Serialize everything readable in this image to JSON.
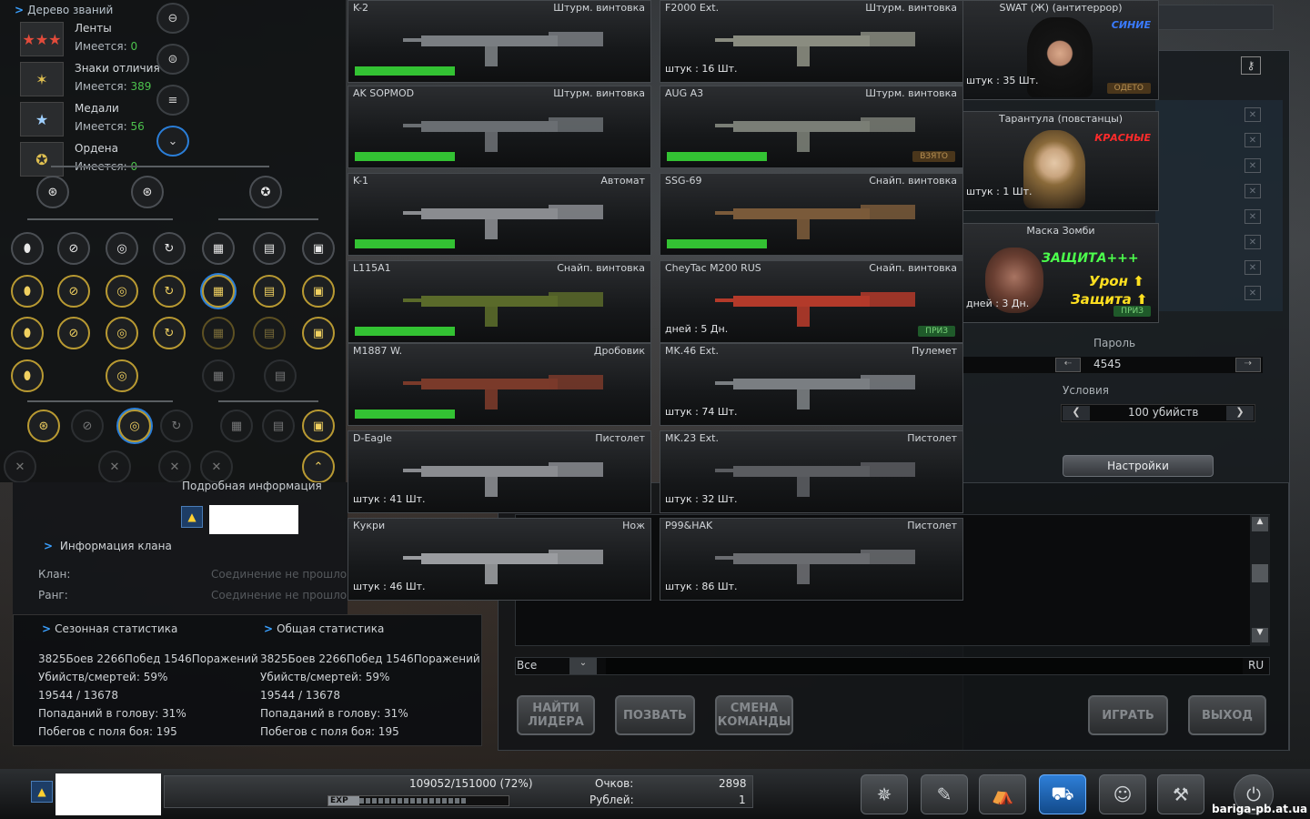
{
  "rank_tree": {
    "title": "Дерево званий",
    "categories": [
      {
        "name": "Ленты",
        "have_label": "Имеется:",
        "count": "0"
      },
      {
        "name": "Знаки отличия",
        "have_label": "Имеется:",
        "count": "389"
      },
      {
        "name": "Медали",
        "have_label": "Имеется:",
        "count": "56"
      },
      {
        "name": "Ордена",
        "have_label": "Имеется:",
        "count": "0"
      }
    ]
  },
  "info": {
    "title": "Подробная информация",
    "clan_header": "Информация клана",
    "clan_label": "Клан:",
    "rank_label": "Ранг:",
    "clan_value": "Соединение не прошло",
    "rank_value": "Соединение не прошло"
  },
  "stats": {
    "season_title": "Сезонная статистика",
    "total_title": "Общая статистика",
    "season": [
      "3825Боев 2266Побед 1546Поражений",
      "Убийств/смертей: 59%",
      "19544 / 13678",
      "Попаданий в голову: 31%",
      "Побегов с поля боя: 195"
    ],
    "total": [
      "3825Боев 2266Побед 1546Поражений",
      "Убийств/смертей: 59%",
      "19544 / 13678",
      "Попаданий в голову: 31%",
      "Побегов с поля боя: 195"
    ]
  },
  "weapons": [
    {
      "name": "K-2",
      "type": "Штурм. винтовка",
      "count": "",
      "bar": 1,
      "tag": ""
    },
    {
      "name": "F2000 Ext.",
      "type": "Штурм. винтовка",
      "count": "штук : 16 Шт.",
      "bar": 0,
      "tag": ""
    },
    {
      "name": "AK SOPMOD",
      "type": "Штурм. винтовка",
      "count": "",
      "bar": 1,
      "tag": ""
    },
    {
      "name": "AUG A3",
      "type": "Штурм. винтовка",
      "count": "",
      "bar": 1,
      "tag": "ВЗЯТО"
    },
    {
      "name": "K-1",
      "type": "Автомат",
      "count": "",
      "bar": 1,
      "tag": ""
    },
    {
      "name": "SSG-69",
      "type": "Снайп. винтовка",
      "count": "",
      "bar": 1,
      "tag": ""
    },
    {
      "name": "L115A1",
      "type": "Снайп. винтовка",
      "count": "",
      "bar": 1,
      "tag": ""
    },
    {
      "name": "CheyTac M200 RUS",
      "type": "Снайп. винтовка",
      "count": "дней : 5 Дн.",
      "bar": 0,
      "tag": "ПРИЗ"
    },
    {
      "name": "M1887 W.",
      "type": "Дробовик",
      "count": "",
      "bar": 1,
      "tag": ""
    },
    {
      "name": "MK.46 Ext.",
      "type": "Пулемет",
      "count": "штук : 74 Шт.",
      "bar": 0,
      "tag": ""
    },
    {
      "name": "D-Eagle",
      "type": "Пистолет",
      "count": "штук : 41 Шт.",
      "bar": 0,
      "tag": ""
    },
    {
      "name": "MK.23 Ext.",
      "type": "Пистолет",
      "count": "штук : 32 Шт.",
      "bar": 0,
      "tag": ""
    },
    {
      "name": "Кукри",
      "type": "Нож",
      "count": "штук : 46 Шт.",
      "bar": 0,
      "tag": ""
    },
    {
      "name": "P99&HAK",
      "type": "Пистолет",
      "count": "штук : 86 Шт.",
      "bar": 0,
      "tag": ""
    }
  ],
  "characters": [
    {
      "name": "SWAT (Ж) (антитеррор)",
      "team": "СИНИЕ",
      "count": "штук : 35 Шт.",
      "tag": "ОДЕТО"
    },
    {
      "name": "Тарантула (повстанцы)",
      "team": "КРАСНЫЕ",
      "count": "штук : 1 Шт.",
      "tag": ""
    },
    {
      "name": "Маска Зомби",
      "count": "дней : 3 Дн.",
      "tag": "ПРИЗ",
      "line1": "ЗАЩИТА+++",
      "line2": "Урон",
      "line3": "Защита"
    }
  ],
  "room": {
    "password_label": "Пароль",
    "password_value": "4545",
    "conditions_label": "Условия",
    "conditions_value": "100 убийств",
    "settings_btn": "Настройки",
    "chat_filter": "Все",
    "lang": "RU"
  },
  "buttons": {
    "find_leader": "НАЙТИ ЛИДЕРА",
    "invite": "ПОЗВАТЬ",
    "change_team": "СМЕНА КОМАНДЫ",
    "play": "ИГРАТЬ",
    "exit": "ВЫХОД"
  },
  "footer": {
    "exp_text": "109052/151000 (72%)",
    "exp_label": "EXP",
    "exp_fraction": 0.72,
    "points_label": "Очков:",
    "points_value": "2898",
    "rubles_label": "Рублей:",
    "rubles_value": "1",
    "watermark": "bariga-pb.at.ua"
  }
}
